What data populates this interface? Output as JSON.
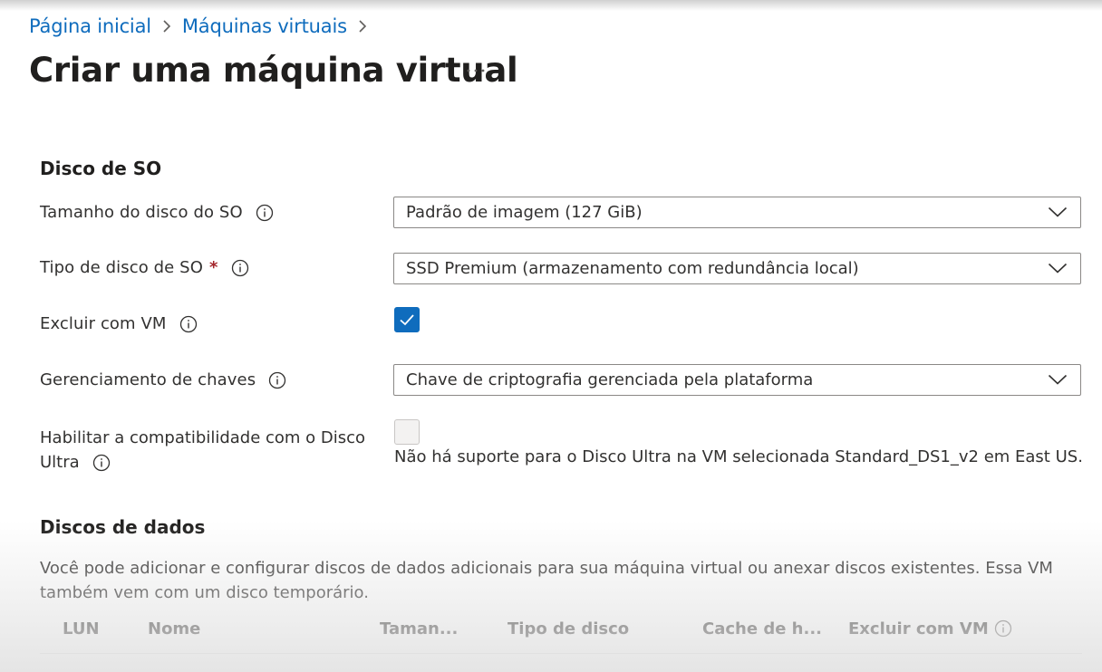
{
  "breadcrumb": [
    {
      "label": "Página inicial"
    },
    {
      "label": "Máquinas virtuais"
    }
  ],
  "page": {
    "title": "Criar uma máquina virtual",
    "more_label": "···"
  },
  "os_disk": {
    "heading": "Disco de SO",
    "size_label": "Tamanho do disco do SO",
    "size_value": "Padrão de imagem (127 GiB)",
    "type_label": "Tipo de disco de SO",
    "type_required": "*",
    "type_value": "SSD Premium (armazenamento com redundância local)",
    "delete_label": "Excluir com VM",
    "delete_checked": true,
    "key_label": "Gerenciamento de chaves",
    "key_value": "Chave de criptografia gerenciada pela plataforma",
    "ultra_label_line1": "Habilitar a compatibilidade com o Disco",
    "ultra_label_line2": "Ultra",
    "ultra_checked": false,
    "ultra_note": "Não há suporte para o Disco Ultra na VM selecionada Standard_DS1_v2 em East US."
  },
  "data_disks": {
    "heading": "Discos de dados",
    "description": "Você pode adicionar e configurar discos de dados adicionais para sua máquina virtual ou anexar discos existentes. Essa VM também vem com um disco temporário.",
    "columns": [
      "LUN",
      "Nome",
      "Taman...",
      "Tipo de disco",
      "Cache de h...",
      "Excluir com VM"
    ]
  },
  "colors": {
    "link": "#0f6cbd",
    "checkbox": "#0f6cbd",
    "required": "#a4262c"
  },
  "icons": [
    "chevron-right-icon",
    "more-icon",
    "info-icon",
    "chevron-down-icon",
    "checkmark-icon"
  ]
}
